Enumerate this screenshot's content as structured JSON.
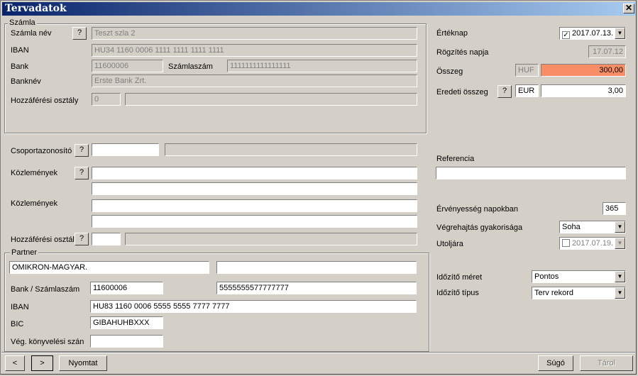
{
  "window": {
    "title": "Tervadatok",
    "close_glyph": "✕"
  },
  "szamla": {
    "group_title": "Számla",
    "nev_label": "Számla név",
    "nev_value": "Teszt szla 2",
    "iban_label": "IBAN",
    "iban_value": "HU34 1160 0006 1111 1111 1111 1111",
    "bank_label": "Bank",
    "bank_value": "11600006",
    "szamlaszam_label": "Számlaszám",
    "szamlaszam_value": "1111111111111111",
    "banknev_label": "Banknév",
    "banknev_value": "Erste Bank Zrt.",
    "hozzaferesi_label": "Hozzáférési osztály",
    "hozzaferesi_value": "0",
    "hozzaferesi_desc": ""
  },
  "help_glyph": "?",
  "right": {
    "erteknap_label": "Értéknap",
    "erteknap_value": "2017.07.13.",
    "rogzites_label": "Rögzítés napja",
    "rogzites_value": "17.07.12",
    "osszeg_label": "Összeg",
    "osszeg_currency": "HUF",
    "osszeg_value": "300,00",
    "eredeti_label": "Eredeti összeg",
    "eredeti_currency": "EUR",
    "eredeti_value": "3,00",
    "referencia_label": "Referencia",
    "referencia_value": "",
    "ervenyesseg_label": "Érvényesség napokban",
    "ervenyesseg_value": "365",
    "gyakorisag_label": "Végrehajtás gyakorisága",
    "gyakorisag_value": "Soha",
    "utoljara_label": "Utoljára",
    "utoljara_value": "2017.07.19.",
    "idozito_meret_label": "Időzítő méret",
    "idozito_meret_value": "Pontos",
    "idozito_tipus_label": "Időzítő típus",
    "idozito_tipus_value": "Terv rekord"
  },
  "middle": {
    "csoport_label": "Csoportazonosító",
    "kozlemenyek1_label": "Közlemények",
    "kozlemenyek2_label": "Közlemények",
    "hozzaferesi_label": "Hozzáférési osztály"
  },
  "partner": {
    "group_title": "Partner",
    "name": "OMIKRON-MAGYAR.",
    "bank_label": "Bank / Számlaszám",
    "bank_value": "11600006",
    "szamlaszam_value": "5555555577777777",
    "iban_label": "IBAN",
    "iban_value": "HU83 1160 0006 5555 5555 7777 7777",
    "bic_label": "BIC",
    "bic_value": "GIBAHUHBXXX",
    "konyvelesi_label": "Vég. könyvelési szán",
    "konyvelesi_value": ""
  },
  "footer": {
    "prev": "<",
    "next": ">",
    "nyomtat": "Nyomtat",
    "sugo": "Súgó",
    "tarol": "Tárol"
  },
  "colors": {
    "highlight": "#f98e66",
    "titlebar": "#0a246a"
  }
}
